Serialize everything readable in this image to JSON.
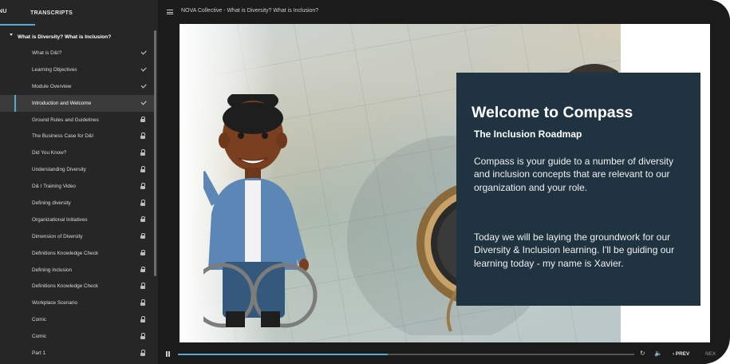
{
  "sidebar": {
    "tabs": {
      "menu": "NU",
      "transcripts": "TRANSCRIPTS"
    },
    "section_title": "What is Diversity? What is Inclusion?",
    "items": [
      {
        "label": "What is D&I?",
        "status": "check"
      },
      {
        "label": "Learning Objectives",
        "status": "check"
      },
      {
        "label": "Module Overview",
        "status": "check"
      },
      {
        "label": "Introduction and Welcome",
        "status": "check",
        "active": true
      },
      {
        "label": "Ground Rules and Guidelines",
        "status": "lock"
      },
      {
        "label": "The Business Case for D&I",
        "status": "lock"
      },
      {
        "label": "Did You Know?",
        "status": "lock"
      },
      {
        "label": "Understanding Diversity",
        "status": "lock"
      },
      {
        "label": "D& I Training Video",
        "status": "lock"
      },
      {
        "label": "Defining diversity",
        "status": "lock"
      },
      {
        "label": "Organizational Initiatives",
        "status": "lock"
      },
      {
        "label": "Dimension of Diversity",
        "status": "lock"
      },
      {
        "label": "Definitions Knowledge Check",
        "status": "lock"
      },
      {
        "label": "Defining inclusion",
        "status": "lock"
      },
      {
        "label": "Definitions Knowledge Check",
        "status": "lock"
      },
      {
        "label": "Workplace Scenario",
        "status": "lock"
      },
      {
        "label": "Comic",
        "status": "lock"
      },
      {
        "label": "Comic",
        "status": "lock"
      },
      {
        "label": "Part 1",
        "status": "lock"
      }
    ]
  },
  "header": {
    "title": "NOVA Collective - What is Diversity? What is Inclusion?"
  },
  "slide": {
    "heading": "Welcome to Compass",
    "subheading": "The Inclusion Roadmap",
    "paragraph1": "Compass is your guide to a number of diversity and inclusion concepts that are relevant to our organization and your role.",
    "paragraph2": "Today we will be laying the groundwork for our Diversity & Inclusion learning. I'll be guiding our learning today - my name is Xavier."
  },
  "player": {
    "prev_label": "PREV",
    "next_label": "NEX",
    "progress": 0.46
  },
  "colors": {
    "accent": "#5aa7d8",
    "card": "#1f3340",
    "sidebar": "#262626"
  }
}
